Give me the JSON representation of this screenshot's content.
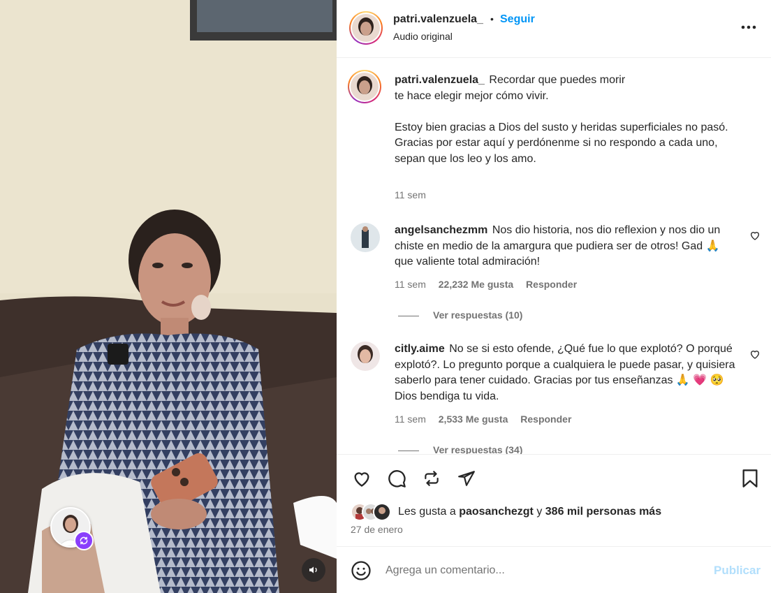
{
  "post": {
    "username": "patri.valenzuela_",
    "separator": "•",
    "follow_label": "Seguir",
    "audio_label": "Audio original"
  },
  "caption": {
    "username": "patri.valenzuela_",
    "line1": "Recordar que puedes morir",
    "line2": "te hace elegir mejor cómo vivir.",
    "line3": "Estoy bien gracias a Dios del susto y heridas superficiales no pasó.",
    "line4": "Gracias por estar aquí y perdónenme si no respondo a cada uno, sepan que los leo y los amo.",
    "time": "11 sem"
  },
  "comments": [
    {
      "username": "angelsanchezmm",
      "text": "Nos dio historia, nos dio reflexion y nos dio un chiste en medio de la amargura que pudiera ser de otros! Gad 🙏 que valiente total admiración!",
      "time": "11 sem",
      "likes": "22,232 Me gusta",
      "reply_label": "Responder",
      "view_replies": "Ver respuestas (10)"
    },
    {
      "username": "citly.aime",
      "text": "No se si esto ofende, ¿Qué fue lo que explotó? O porqué explotó?. Lo pregunto porque a cualquiera le puede pasar, y quisiera saberlo para tener cuidado. Gracias por tus enseñanzas 🙏 💗 🥺 Dios bendiga tu vida.",
      "time": "11 sem",
      "likes": "2,533 Me gusta",
      "reply_label": "Responder",
      "view_replies": "Ver respuestas (34)"
    }
  ],
  "likes": {
    "prefix": "Les gusta a",
    "user": "paosanchezgt",
    "connector": "y",
    "others": "386 mil personas más"
  },
  "date": "27 de enero",
  "compose": {
    "placeholder": "Agrega un comentario...",
    "publish_label": "Publicar"
  },
  "icons": {
    "like": "heart-icon",
    "comment": "comment-icon",
    "share_remix": "repost-icon",
    "send": "send-icon",
    "save": "bookmark-icon",
    "more": "more-options-icon",
    "emoji": "emoji-icon",
    "audio": "speaker-icon",
    "remix": "remix-icon"
  },
  "colors": {
    "link_blue": "#0095f6",
    "publish_disabled": "#b2dffc",
    "secondary_text": "#737373",
    "remix_purple": "#8a3ffc"
  }
}
